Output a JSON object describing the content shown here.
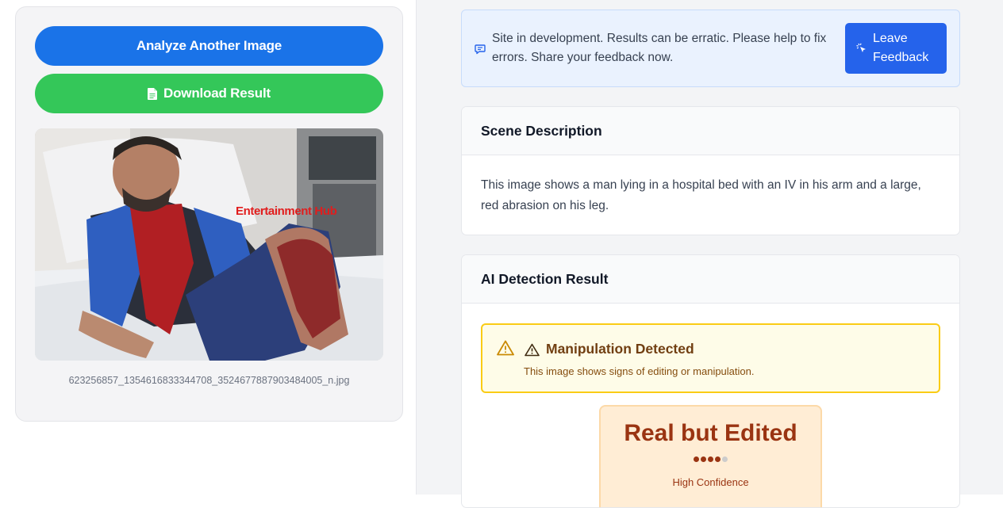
{
  "left": {
    "analyze_button": "Analyze Another Image",
    "download_button": "Download Result",
    "image_watermark": "Entertainment Hub",
    "filename": "623256857_1354616833344708_3524677887903484005_n.jpg"
  },
  "notice": {
    "text": "Site in development. Results can be erratic. Please help to fix errors. Share your feedback now.",
    "button": "Leave Feedback",
    "icon": "message-square-icon",
    "button_icon": "sparkle-click-icon"
  },
  "scene": {
    "title": "Scene Description",
    "text": "This image shows a man lying in a hospital bed with an IV in his arm and a large, red abrasion on his leg."
  },
  "detection": {
    "title": "AI Detection Result",
    "alert_title": "Manipulation Detected",
    "alert_text": "This image shows signs of editing or manipulation.",
    "verdict": "Real but Edited",
    "confidence_level": 4,
    "confidence_max": 5,
    "confidence_label": "High Confidence"
  },
  "colors": {
    "primary": "#1a73e8",
    "success": "#34c759",
    "warning_border": "#facc15",
    "verdict_text": "#9a3412"
  }
}
